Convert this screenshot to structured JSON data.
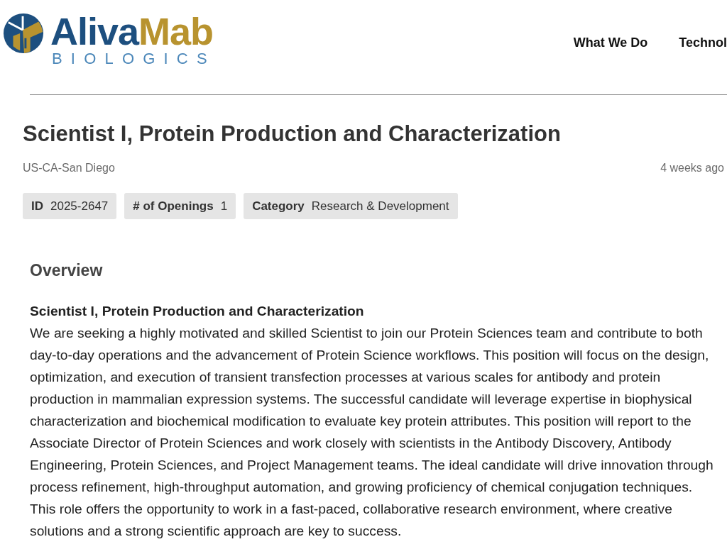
{
  "header": {
    "logo": {
      "wordmark": [
        "Aliva",
        "Mab"
      ],
      "tagline": "BIOLOGICS"
    },
    "nav": [
      "What We Do",
      "Technol"
    ]
  },
  "job": {
    "title": "Scientist I, Protein Production and Characterization",
    "location": "US-CA-San Diego",
    "posted": "4 weeks ago",
    "tags": [
      {
        "label": "ID",
        "value": "2025-2647"
      },
      {
        "label": "# of Openings",
        "value": "1"
      },
      {
        "label": "Category",
        "value": "Research & Development"
      }
    ]
  },
  "overview": {
    "heading": "Overview",
    "subheading": "Scientist I, Protein Production and Characterization",
    "body": "We are seeking a highly motivated and skilled Scientist to join our Protein Sciences team and contribute to both day-to-day operations and the advancement of Protein Science workflows. This position will focus on the design, optimization, and execution of transient transfection processes at various scales for antibody and protein production in mammalian expression systems. The successful candidate will leverage expertise in biophysical characterization and biochemical modification to evaluate key protein attributes. This position will report to the Associate Director of Protein Sciences and work closely with scientists in the Antibody Discovery, Antibody Engineering, Protein Sciences, and Project Management teams. The ideal candidate will drive innovation through process refinement, high-throughput automation, and growing proficiency of chemical conjugation techniques. This role offers the opportunity to work in a fast-paced, collaborative research environment, where creative solutions and a strong scientific approach are key to success."
  }
}
